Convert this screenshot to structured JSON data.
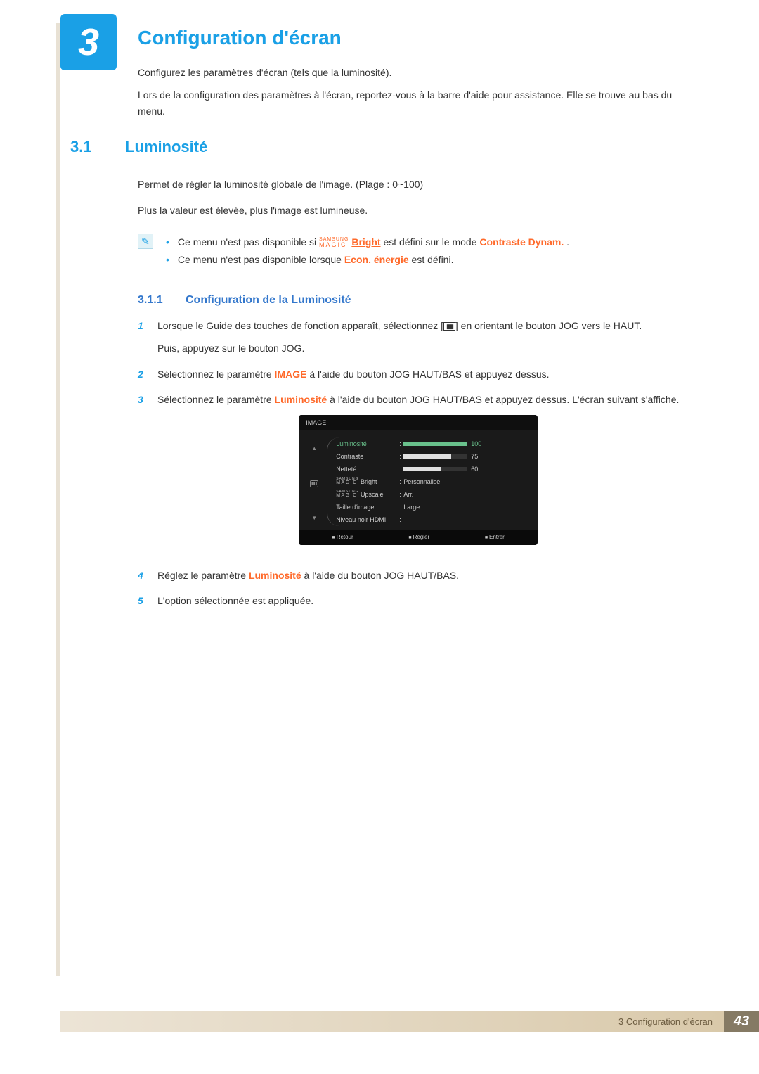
{
  "chapter": {
    "number": "3",
    "title": "Configuration d'écran",
    "footer_label": "3 Configuration d'écran"
  },
  "page_number": "43",
  "intro": {
    "p1": "Configurez les paramètres d'écran (tels que la luminosité).",
    "p2": "Lors de la configuration des paramètres à l'écran, reportez-vous à la barre d'aide pour assistance. Elle se trouve au bas du menu."
  },
  "section": {
    "num": "3.1",
    "title": "Luminosité",
    "p1": "Permet de régler la luminosité globale de l'image. (Plage : 0~100)",
    "p2": "Plus la valeur est élevée, plus l'image est lumineuse."
  },
  "notes": {
    "logo_top": "SAMSUNG",
    "logo_bot": "MAGIC",
    "n1_a": "Ce menu n'est pas disponible si ",
    "n1_link": "Bright",
    "n1_b": " est défini sur le mode ",
    "n1_mode": "Contraste Dynam.",
    "n1_c": ".",
    "n2_a": "Ce menu n'est pas disponible lorsque ",
    "n2_link": "Econ. énergie",
    "n2_b": " est défini."
  },
  "subsection": {
    "num": "3.1.1",
    "title": "Configuration de la Luminosité"
  },
  "steps": {
    "s1a": "Lorsque le Guide des touches de fonction apparaît, sélectionnez [",
    "s1b": "] en orientant le bouton JOG vers le HAUT.",
    "s1c": "Puis, appuyez sur le bouton JOG.",
    "s2a": "Sélectionnez le paramètre ",
    "s2_kw": "IMAGE",
    "s2b": " à l'aide du bouton JOG HAUT/BAS et appuyez dessus.",
    "s3a": "Sélectionnez le paramètre ",
    "s3_kw": "Luminosité",
    "s3b": " à l'aide du bouton JOG HAUT/BAS et appuyez dessus. L'écran suivant s'affiche.",
    "s4a": "Réglez le paramètre ",
    "s4_kw": "Luminosité",
    "s4b": " à l'aide du bouton JOG HAUT/BAS.",
    "s5": "L'option sélectionnée est appliquée."
  },
  "osd": {
    "header": "IMAGE",
    "logo_top": "SAMSUNG",
    "logo_bot": "MAGIC",
    "rows": [
      {
        "label": "Luminosité",
        "bar_pct": 100,
        "bar_color": "#69c18c",
        "num": "100",
        "highlight": true
      },
      {
        "label": "Contraste",
        "bar_pct": 75,
        "bar_color": "#e0e0e0",
        "num": "75"
      },
      {
        "label": "Netteté",
        "bar_pct": 60,
        "bar_color": "#e0e0e0",
        "num": "60"
      },
      {
        "label": "Bright",
        "magic": true,
        "value": "Personnalisé"
      },
      {
        "label": "Upscale",
        "magic": true,
        "value": "Arr."
      },
      {
        "label": "Taille d'image",
        "value": "Large"
      },
      {
        "label": "Niveau noir HDMI",
        "value": ""
      }
    ],
    "footer": {
      "back": "Retour",
      "adjust": "Régler",
      "enter": "Entrer"
    }
  }
}
